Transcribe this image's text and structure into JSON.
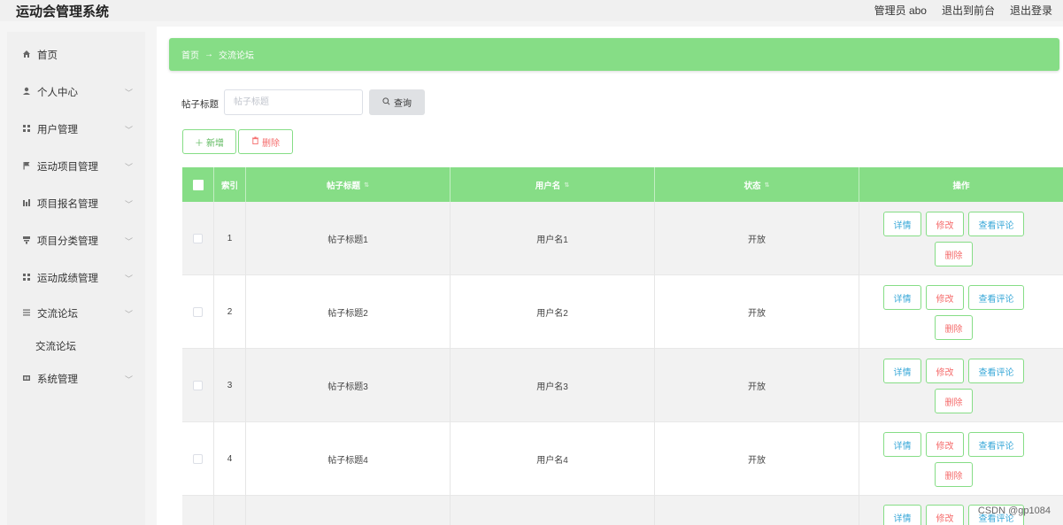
{
  "header": {
    "app_title": "运动会管理系统",
    "admin_label": "管理员 abo",
    "exit_front": "退出到前台",
    "logout": "退出登录"
  },
  "sidebar": {
    "items": [
      {
        "label": "首页",
        "icon": "home-icon",
        "chevron": false
      },
      {
        "label": "个人中心",
        "icon": "user-icon",
        "chevron": true
      },
      {
        "label": "用户管理",
        "icon": "grid-icon",
        "chevron": true
      },
      {
        "label": "运动项目管理",
        "icon": "flag-icon",
        "chevron": true
      },
      {
        "label": "项目报名管理",
        "icon": "bar-chart-icon",
        "chevron": true
      },
      {
        "label": "项目分类管理",
        "icon": "category-icon",
        "chevron": true
      },
      {
        "label": "运动成绩管理",
        "icon": "grid-icon",
        "chevron": true
      },
      {
        "label": "交流论坛",
        "icon": "menu-icon",
        "chevron": true,
        "expanded": true
      },
      {
        "label": "系统管理",
        "icon": "settings-icon",
        "chevron": true
      }
    ],
    "subitem": "交流论坛"
  },
  "breadcrumb": {
    "home": "首页",
    "arrow": "→",
    "current": "交流论坛"
  },
  "search": {
    "label": "帖子标题",
    "placeholder": "帖子标题",
    "button": "查询"
  },
  "actions": {
    "add": "新增",
    "delete": "删除"
  },
  "table": {
    "columns": [
      "索引",
      "帖子标题",
      "用户名",
      "状态",
      "操作"
    ],
    "rows": [
      {
        "index": "1",
        "title": "帖子标题1",
        "user": "用户名1",
        "status": "开放"
      },
      {
        "index": "2",
        "title": "帖子标题2",
        "user": "用户名2",
        "status": "开放"
      },
      {
        "index": "3",
        "title": "帖子标题3",
        "user": "用户名3",
        "status": "开放"
      },
      {
        "index": "4",
        "title": "帖子标题4",
        "user": "用户名4",
        "status": "开放"
      }
    ],
    "ops": {
      "detail": "详情",
      "edit": "修改",
      "comment": "查看评论",
      "remove": "删除"
    }
  },
  "watermark": "CSDN @gp1084",
  "colors": {
    "accent": "#86dd86",
    "danger": "#f56c6c",
    "link": "#39a8d8"
  }
}
